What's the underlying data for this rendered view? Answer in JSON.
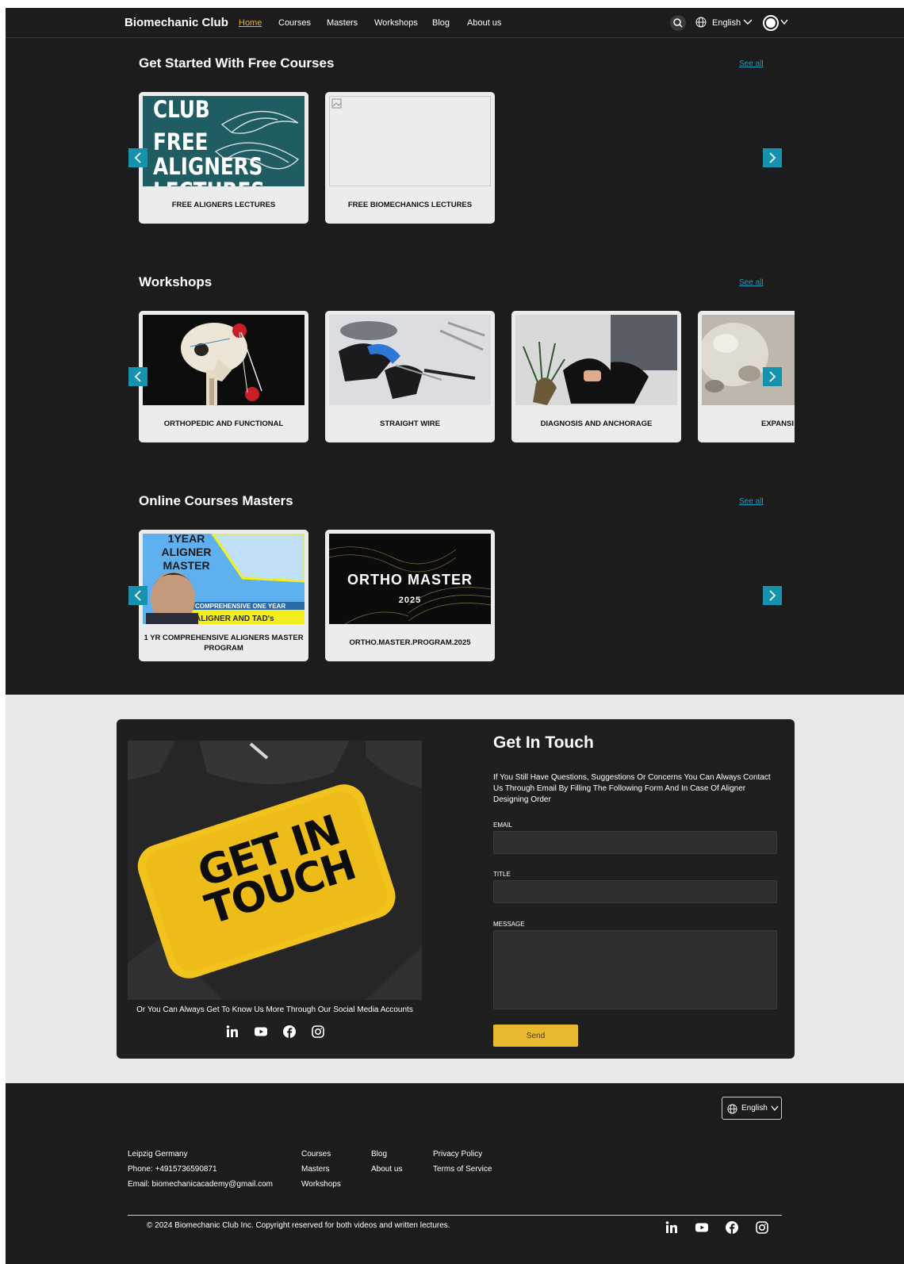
{
  "nav": {
    "brand": "Biomechanic Club",
    "links": [
      "Home",
      "Courses",
      "Masters",
      "Workshops",
      "Blog",
      "About us"
    ],
    "language": "English"
  },
  "free_courses": {
    "title": "Get Started With Free Courses",
    "see_all": "See all",
    "cards": [
      {
        "title": "FREE ALIGNERS LECTURES",
        "image_text": [
          "CLUB",
          "FREE",
          "ALIGNERS",
          "LECTURES"
        ]
      },
      {
        "title": "FREE BIOMECHANICS LECTURES"
      }
    ]
  },
  "workshops": {
    "title": "Workshops",
    "see_all": "See all",
    "cards": [
      {
        "title": "ORTHOPEDIC AND FUNCTIONAL"
      },
      {
        "title": "STRAIGHT WIRE"
      },
      {
        "title": "DIAGNOSIS AND ANCHORAGE"
      },
      {
        "title": "EXPANSI"
      }
    ]
  },
  "masters": {
    "title": "Online Courses Masters",
    "see_all": "See all",
    "cards": [
      {
        "title": "1 YR COMPREHENSIVE ALIGNERS MASTER PROGRAM",
        "image_text": [
          "1YEAR",
          "ALIGNER",
          "MASTER",
          "COMPREHENSIVE ONE YEAR",
          "ALIGNER AND TAD's"
        ]
      },
      {
        "title": "ORTHO.MASTER.PROGRAM.2025",
        "image_text": [
          "ORTHO MASTER",
          "2025"
        ]
      }
    ]
  },
  "contact": {
    "image_text": [
      "GET IN",
      "TOUCH"
    ],
    "social_text": "Or You Can Always Get To Know Us More Through Our Social Media Accounts",
    "heading": "Get In Touch",
    "description": "If You Still Have Questions, Suggestions Or Concerns You Can Always Contact Us Through Email By Filling The Following Form And In Case Of Aligner Designing Order",
    "email_label": "EMAIL",
    "title_label": "TITLE",
    "message_label": "MESSAGE",
    "email_value": "",
    "title_value": "",
    "message_value": "",
    "send_label": "Send"
  },
  "footer": {
    "language": "English",
    "address": "Leipzig Germany",
    "phone": "Phone: +4915736590871",
    "email": "Email: biomechanicacademy@gmail.com",
    "col1": [
      "Courses",
      "Masters",
      "Workshops"
    ],
    "col2": [
      "Blog",
      "About us"
    ],
    "col3": [
      "Privacy Policy",
      "Terms of Service"
    ],
    "copyright": "© 2024 Biomechanic Club Inc. Copyright reserved for both videos and written lectures."
  },
  "colors": {
    "background": "#1c1c1c",
    "accent_link": "#1f9bc0",
    "arrow": "#1593ad",
    "active_nav": "#e6b32e",
    "send_button": "#e8b82f"
  },
  "icons": [
    "search-icon",
    "globe-icon",
    "chevron-down-icon",
    "theme-toggle-icon",
    "chevron-left-icon",
    "chevron-right-icon",
    "linkedin-icon",
    "youtube-icon",
    "facebook-icon",
    "instagram-icon"
  ]
}
